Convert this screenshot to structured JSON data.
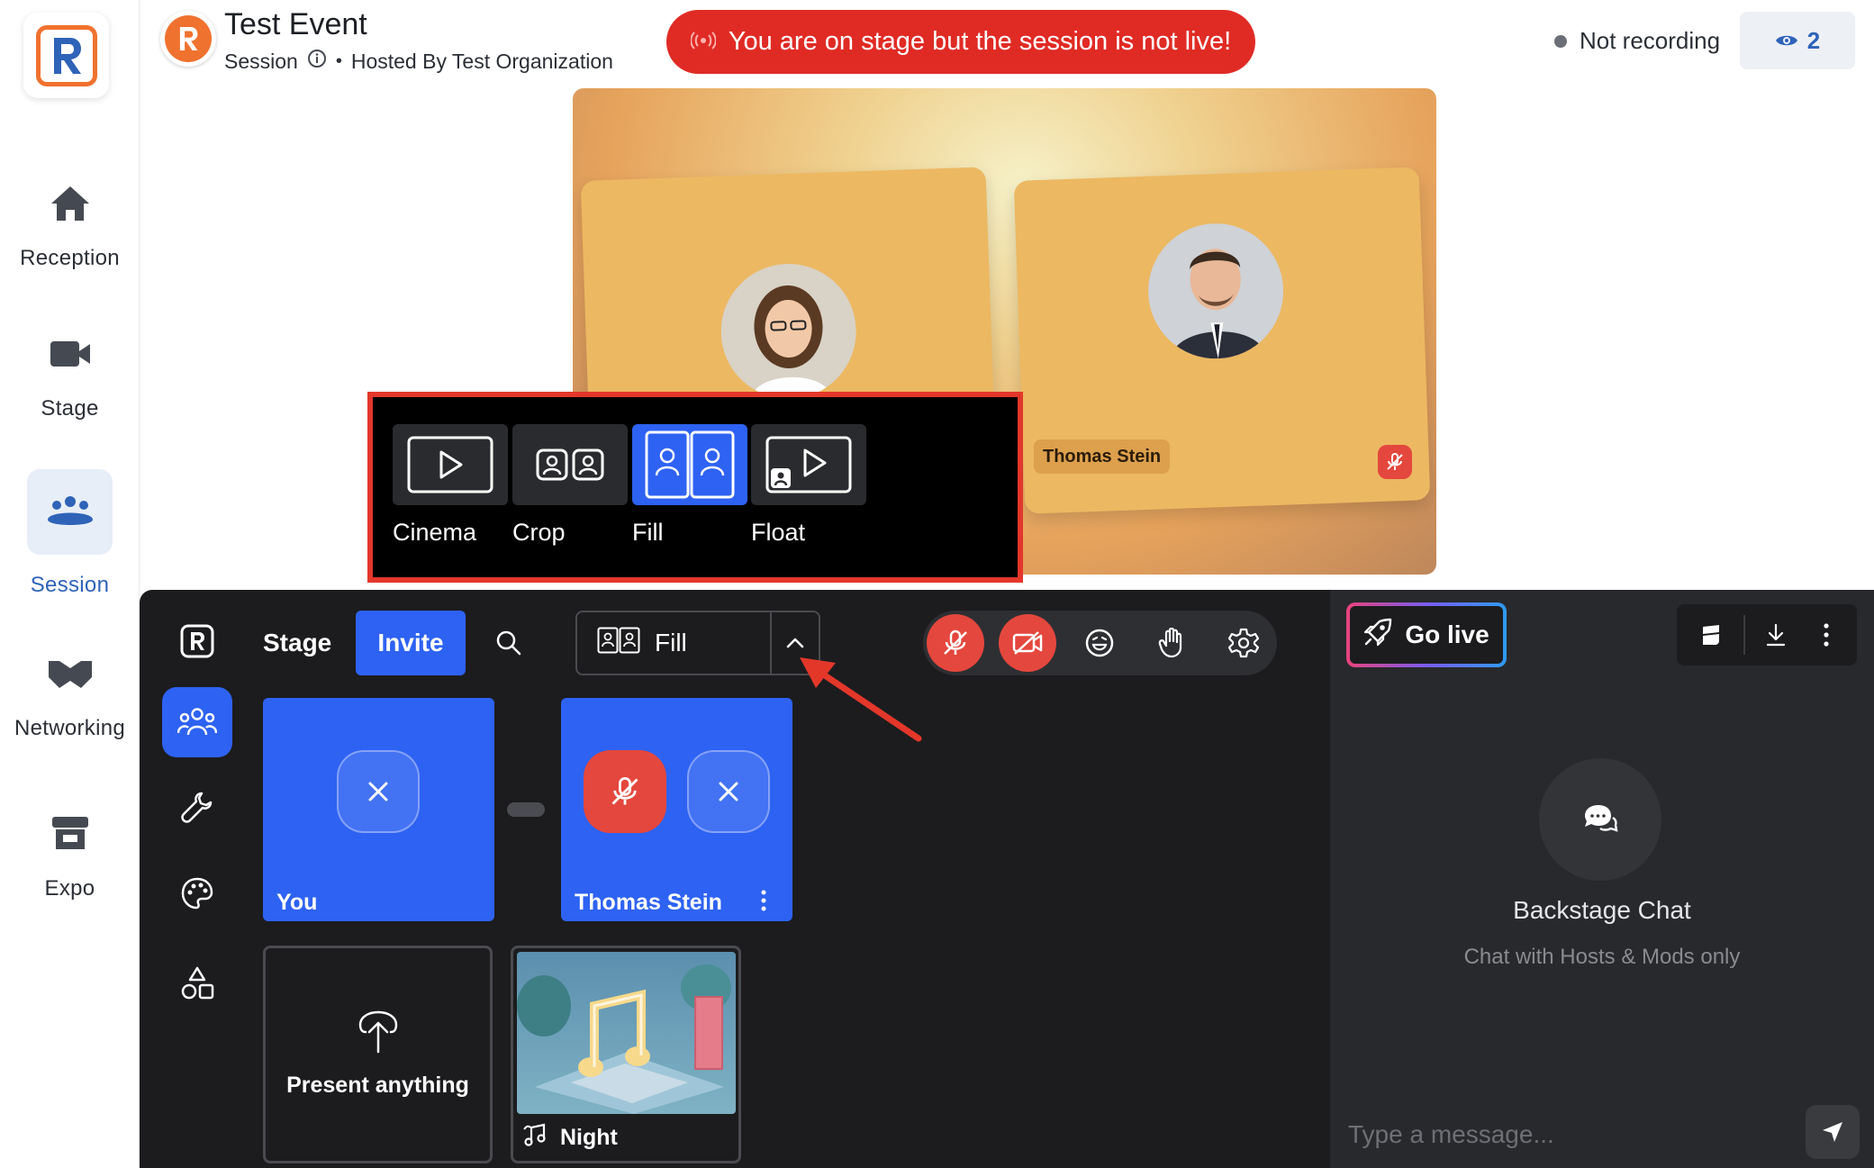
{
  "nav": {
    "items": [
      {
        "label": "Reception",
        "icon": "home-icon"
      },
      {
        "label": "Stage",
        "icon": "video-camera-icon"
      },
      {
        "label": "Session",
        "icon": "group-icon",
        "active": true
      },
      {
        "label": "Networking",
        "icon": "handshake-icon"
      },
      {
        "label": "Expo",
        "icon": "booth-icon"
      }
    ]
  },
  "header": {
    "title": "Test Event",
    "session_label": "Session",
    "hosted_by": "Hosted By Test Organization",
    "live_banner": "You are on stage but the session is not live!",
    "recording_status": "Not recording",
    "viewer_count": "2"
  },
  "stage": {
    "participants": [
      {
        "name": "",
        "muted": false
      },
      {
        "name": "Thomas Stein",
        "muted": true
      }
    ]
  },
  "layout_popup": {
    "options": [
      {
        "label": "Cinema",
        "icon": "cinema-layout-icon"
      },
      {
        "label": "Crop",
        "icon": "crop-layout-icon"
      },
      {
        "label": "Fill",
        "icon": "fill-layout-icon",
        "selected": true
      },
      {
        "label": "Float",
        "icon": "float-layout-icon"
      }
    ]
  },
  "backstage": {
    "stage_tab": "Stage",
    "invite_label": "Invite",
    "layout_value": "Fill",
    "cards": [
      {
        "name": "You"
      },
      {
        "name": "Thomas Stein",
        "muted": true
      }
    ],
    "present_label": "Present anything",
    "night_label": "Night"
  },
  "chat": {
    "go_live_label": "Go live",
    "title": "Backstage Chat",
    "subtitle": "Chat with Hosts & Mods only",
    "placeholder": "Type a message..."
  },
  "colors": {
    "accent_blue": "#2e62f2",
    "danger_red": "#e02b25",
    "brand_orange": "#f0722f",
    "panel_dark": "#1c1c1e"
  }
}
